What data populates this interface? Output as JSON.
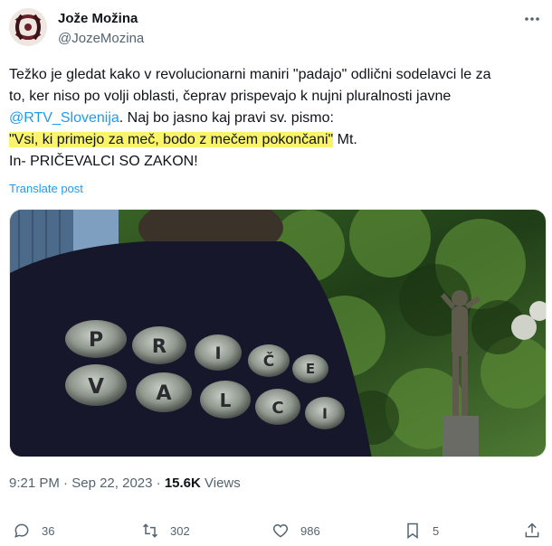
{
  "author": {
    "name": "Jože Možina",
    "handle": "@JozeMozina",
    "avatar_icon": "avatar-icon"
  },
  "post": {
    "line1": "Težko je gledat kako v revolucionarni maniri \"padajo\" odlični sodelavci le za",
    "line2": "to, ker niso po volji oblasti, čeprav prispevajo k nujni pluralnosti javne",
    "mention": "@RTV_Slovenija",
    "line3_rest": ". Naj bo jasno kaj pravi sv. pismo:",
    "quote": "\"Vsi, ki primejo za meč, bodo z mečem pokončani\"",
    "quote_suffix": " Mt.",
    "line5": "In- PRIČEVALCI SO ZAKON!",
    "translate_label": "Translate post"
  },
  "media": {
    "shirt_letters": [
      "P",
      "R",
      "I",
      "Č",
      "E",
      "V",
      "A",
      "L",
      "C",
      "I"
    ]
  },
  "meta": {
    "time": "9:21 PM",
    "separator": " · ",
    "date": "Sep 22, 2023",
    "separator2": " · ",
    "views_count": "15.6K",
    "views_label": " Views"
  },
  "actions": {
    "replies": "36",
    "reposts": "302",
    "likes": "986",
    "bookmarks": "5"
  },
  "colors": {
    "link": "#1d9bf0",
    "highlight": "#fbf46a",
    "secondary": "#536471"
  }
}
